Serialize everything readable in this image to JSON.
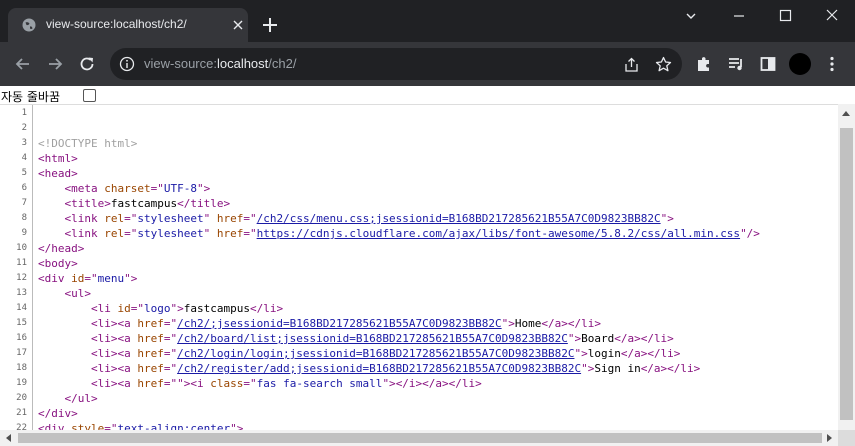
{
  "tab": {
    "title": "view-source:localhost/ch2/"
  },
  "address": {
    "scheme": "view-source:",
    "host": "localhost",
    "path": "/ch2/"
  },
  "wrap": {
    "label": "자동 줄바꿈",
    "checked": false
  },
  "source_lines": [
    [],
    [],
    [
      [
        "cm",
        "<!DOCTYPE html>"
      ]
    ],
    [
      [
        "tag",
        "<html>"
      ]
    ],
    [
      [
        "tag",
        "<head>"
      ]
    ],
    [
      [
        "txt",
        "    "
      ],
      [
        "tag",
        "<meta "
      ],
      [
        "an",
        "charset"
      ],
      [
        "tag",
        "=\""
      ],
      [
        "av",
        "UTF-8"
      ],
      [
        "tag",
        "\">"
      ]
    ],
    [
      [
        "txt",
        "    "
      ],
      [
        "tag",
        "<title>"
      ],
      [
        "txt",
        "fastcampus"
      ],
      [
        "tag",
        "</title>"
      ]
    ],
    [
      [
        "txt",
        "    "
      ],
      [
        "tag",
        "<link "
      ],
      [
        "an",
        "rel"
      ],
      [
        "tag",
        "=\""
      ],
      [
        "av",
        "stylesheet"
      ],
      [
        "tag",
        "\" "
      ],
      [
        "an",
        "href"
      ],
      [
        "tag",
        "=\""
      ],
      [
        "lk",
        "/ch2/css/menu.css;jsessionid=B168BD217285621B55A7C0D9823BB82C"
      ],
      [
        "tag",
        "\">"
      ]
    ],
    [
      [
        "txt",
        "    "
      ],
      [
        "tag",
        "<link "
      ],
      [
        "an",
        "rel"
      ],
      [
        "tag",
        "=\""
      ],
      [
        "av",
        "stylesheet"
      ],
      [
        "tag",
        "\" "
      ],
      [
        "an",
        "href"
      ],
      [
        "tag",
        "=\""
      ],
      [
        "lk",
        "https://cdnjs.cloudflare.com/ajax/libs/font-awesome/5.8.2/css/all.min.css"
      ],
      [
        "tag",
        "\"/>"
      ]
    ],
    [
      [
        "tag",
        "</head>"
      ]
    ],
    [
      [
        "tag",
        "<body>"
      ]
    ],
    [
      [
        "tag",
        "<div "
      ],
      [
        "an",
        "id"
      ],
      [
        "tag",
        "=\""
      ],
      [
        "av",
        "menu"
      ],
      [
        "tag",
        "\">"
      ]
    ],
    [
      [
        "txt",
        "    "
      ],
      [
        "tag",
        "<ul>"
      ]
    ],
    [
      [
        "txt",
        "        "
      ],
      [
        "tag",
        "<li "
      ],
      [
        "an",
        "id"
      ],
      [
        "tag",
        "=\""
      ],
      [
        "av",
        "logo"
      ],
      [
        "tag",
        "\">"
      ],
      [
        "txt",
        "fastcampus"
      ],
      [
        "tag",
        "</li>"
      ]
    ],
    [
      [
        "txt",
        "        "
      ],
      [
        "tag",
        "<li><a "
      ],
      [
        "an",
        "href"
      ],
      [
        "tag",
        "=\""
      ],
      [
        "lk",
        "/ch2/;jsessionid=B168BD217285621B55A7C0D9823BB82C"
      ],
      [
        "tag",
        "\">"
      ],
      [
        "txt",
        "Home"
      ],
      [
        "tag",
        "</a></li>"
      ]
    ],
    [
      [
        "txt",
        "        "
      ],
      [
        "tag",
        "<li><a "
      ],
      [
        "an",
        "href"
      ],
      [
        "tag",
        "=\""
      ],
      [
        "lk",
        "/ch2/board/list;jsessionid=B168BD217285621B55A7C0D9823BB82C"
      ],
      [
        "tag",
        "\">"
      ],
      [
        "txt",
        "Board"
      ],
      [
        "tag",
        "</a></li>"
      ]
    ],
    [
      [
        "txt",
        "        "
      ],
      [
        "tag",
        "<li><a "
      ],
      [
        "an",
        "href"
      ],
      [
        "tag",
        "=\""
      ],
      [
        "lk",
        "/ch2/login/login;jsessionid=B168BD217285621B55A7C0D9823BB82C"
      ],
      [
        "tag",
        "\">"
      ],
      [
        "txt",
        "login"
      ],
      [
        "tag",
        "</a></li>"
      ]
    ],
    [
      [
        "txt",
        "        "
      ],
      [
        "tag",
        "<li><a "
      ],
      [
        "an",
        "href"
      ],
      [
        "tag",
        "=\""
      ],
      [
        "lk",
        "/ch2/register/add;jsessionid=B168BD217285621B55A7C0D9823BB82C"
      ],
      [
        "tag",
        "\">"
      ],
      [
        "txt",
        "Sign in"
      ],
      [
        "tag",
        "</a></li>"
      ]
    ],
    [
      [
        "txt",
        "        "
      ],
      [
        "tag",
        "<li><a "
      ],
      [
        "an",
        "href"
      ],
      [
        "tag",
        "=\""
      ],
      [
        "tag",
        "\">"
      ],
      [
        "tag",
        "<i "
      ],
      [
        "an",
        "class"
      ],
      [
        "tag",
        "=\""
      ],
      [
        "av",
        "fas fa-search small"
      ],
      [
        "tag",
        "\">"
      ],
      [
        "tag",
        "</i></a></li>"
      ]
    ],
    [
      [
        "txt",
        "    "
      ],
      [
        "tag",
        "</ul>"
      ]
    ],
    [
      [
        "tag",
        "</div>"
      ]
    ],
    [
      [
        "tag",
        "<div "
      ],
      [
        "an",
        "style"
      ],
      [
        "tag",
        "=\""
      ],
      [
        "av",
        "text-align:center"
      ],
      [
        "tag",
        "\">"
      ]
    ]
  ],
  "colors": {
    "tag": "#881280",
    "attr_name": "#994500",
    "attr_value": "#1a1aa6",
    "comment": "#a0a0a0",
    "titlebar": "#202124",
    "toolbar": "#35363a"
  },
  "icons": {
    "tab": "globe-icon",
    "close": "close-icon",
    "new_tab": "plus-icon",
    "back": "back-arrow-icon",
    "forward": "forward-arrow-icon",
    "reload": "reload-icon",
    "site_info": "info-icon",
    "share": "share-icon",
    "bookmark": "star-icon",
    "extensions": "puzzle-icon",
    "media": "media-control-icon",
    "side_panel": "side-panel-icon",
    "profile": "profile-avatar-icon",
    "menu": "kebab-menu-icon",
    "minimize": "minimize-icon",
    "maximize": "maximize-icon",
    "window_close": "window-close-icon"
  }
}
